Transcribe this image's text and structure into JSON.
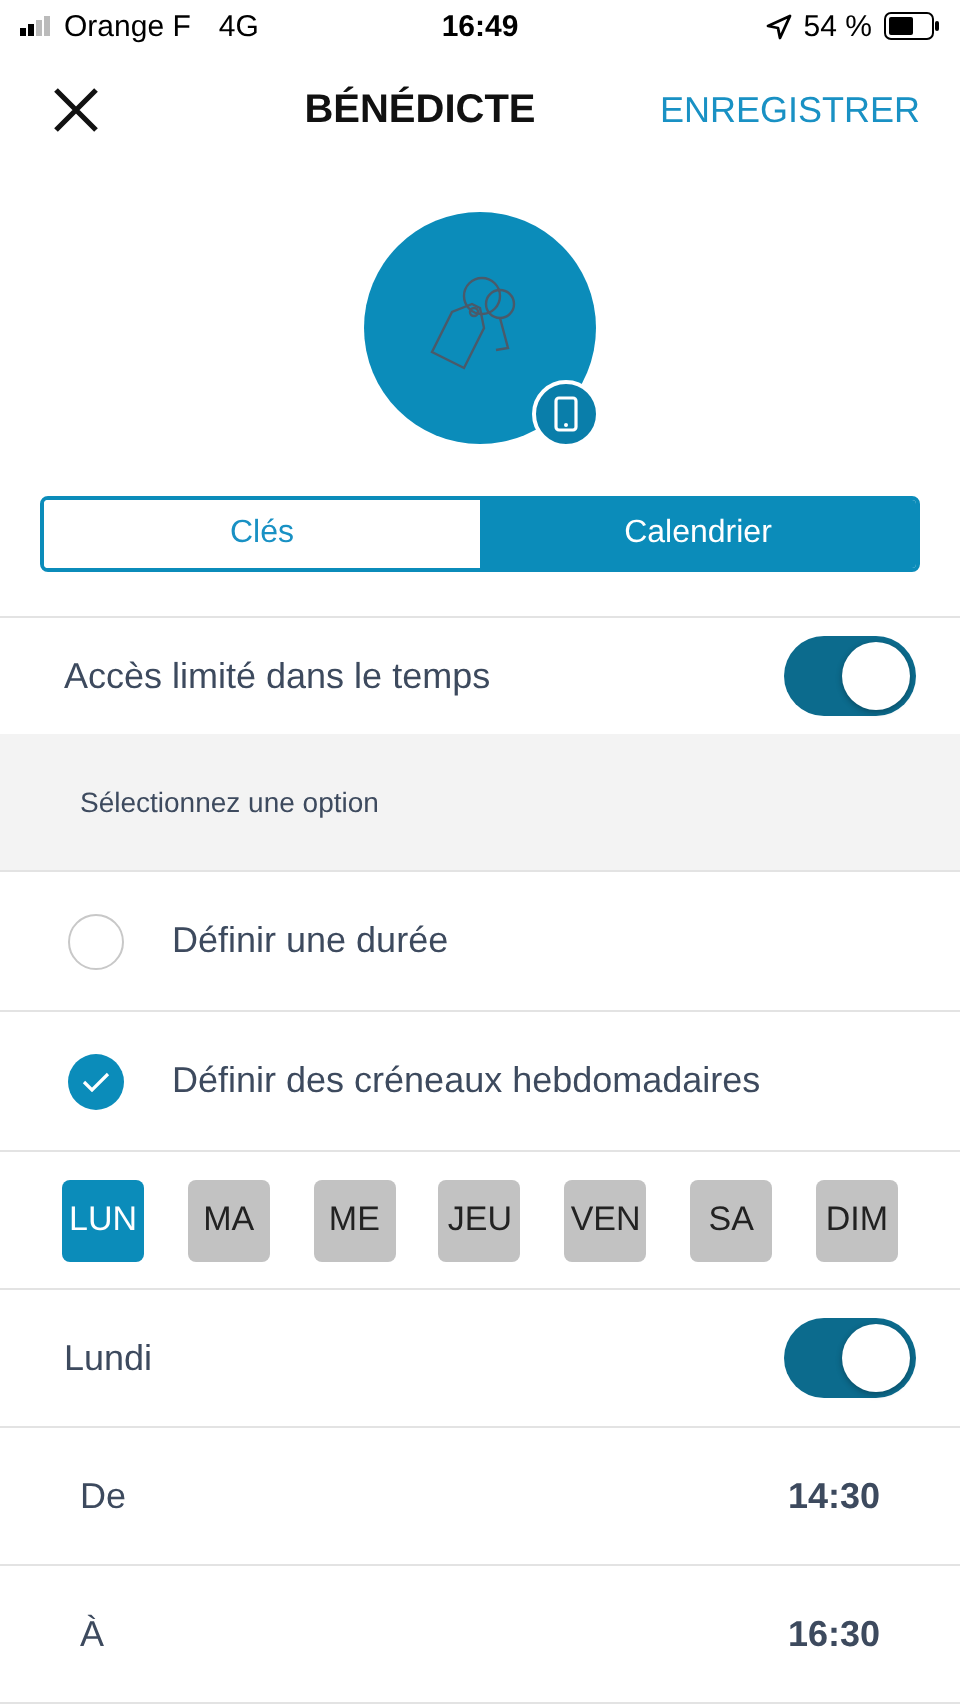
{
  "status_bar": {
    "carrier": "Orange F",
    "network": "4G",
    "time": "16:49",
    "battery": "54 %"
  },
  "nav": {
    "title": "BÉNÉDICTE",
    "action": "ENREGISTRER"
  },
  "tabs": [
    {
      "label": "Clés",
      "selected": false
    },
    {
      "label": "Calendrier",
      "selected": true
    }
  ],
  "time_limited": {
    "label": "Accès limité dans le temps",
    "on": true
  },
  "options_header": "Sélectionnez une option",
  "options": [
    {
      "label": "Définir une durée",
      "selected": false
    },
    {
      "label": "Définir des créneaux hebdomadaires",
      "selected": true
    }
  ],
  "days": [
    {
      "label": "LUN",
      "selected": true
    },
    {
      "label": "MA",
      "selected": false
    },
    {
      "label": "ME",
      "selected": false
    },
    {
      "label": "JEU",
      "selected": false
    },
    {
      "label": "VEN",
      "selected": false
    },
    {
      "label": "SA",
      "selected": false
    },
    {
      "label": "DIM",
      "selected": false
    }
  ],
  "day_toggle": {
    "label": "Lundi",
    "on": true
  },
  "times": [
    {
      "label": "De",
      "value": "14:30"
    },
    {
      "label": "À",
      "value": "16:30"
    }
  ]
}
